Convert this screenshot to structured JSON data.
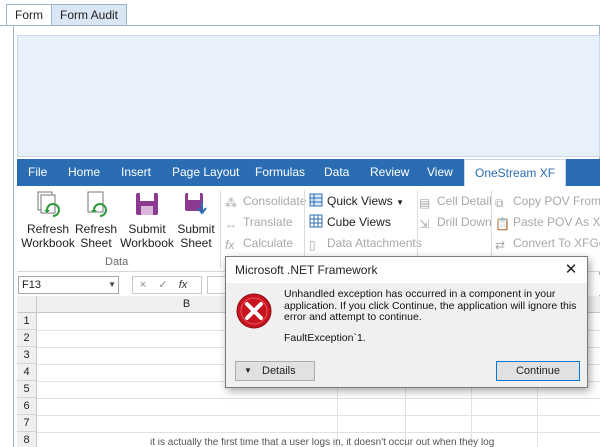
{
  "tabs": [
    {
      "label": "Form",
      "active": true
    },
    {
      "label": "Form Audit",
      "active": false
    }
  ],
  "ribbon_tabs": [
    "File",
    "Home",
    "Insert",
    "Page Layout",
    "Formulas",
    "Data",
    "Review",
    "View",
    "OneStream XF"
  ],
  "ribbon": {
    "data_group": {
      "label": "Data",
      "buttons": [
        {
          "line1": "Refresh",
          "line2": "Workbook",
          "icon": "refresh-workbook-icon"
        },
        {
          "line1": "Refresh",
          "line2": "Sheet",
          "icon": "refresh-sheet-icon"
        },
        {
          "line1": "Submit",
          "line2": "Workbook",
          "icon": "submit-workbook-icon"
        },
        {
          "line1": "Submit",
          "line2": "Sheet",
          "icon": "submit-sheet-icon"
        }
      ]
    },
    "calc": [
      "Consolidate",
      "Translate",
      "Calculate"
    ],
    "views": [
      "Quick Views",
      "Cube Views",
      "Data Attachments"
    ],
    "cell": [
      "Cell Detail",
      "Drill Down"
    ],
    "pov": [
      "Copy POV From D",
      "Paste POV As XFG",
      "Convert To XFGet"
    ]
  },
  "formula_bar": {
    "name_box": "F13",
    "cancel": "×",
    "enter": "✓",
    "fx": "fx"
  },
  "grid": {
    "column": "B",
    "rows": [
      "1",
      "2",
      "3",
      "4",
      "5",
      "6",
      "7",
      "8"
    ]
  },
  "dialog": {
    "title": "Microsoft .NET Framework",
    "message": "Unhandled exception has occurred in a component in your application. If you click Continue, the application will ignore this error and attempt to continue.",
    "exception": "FaultException`1.",
    "details_label": "Details",
    "continue_label": "Continue"
  },
  "bottom_text": "it is actually the first time that a user logs in, it doesn't occur out when they log",
  "colors": {
    "ribbon_blue": "#2b6db3",
    "panel": "#e8f1fb",
    "error_red": "#c8141e"
  }
}
